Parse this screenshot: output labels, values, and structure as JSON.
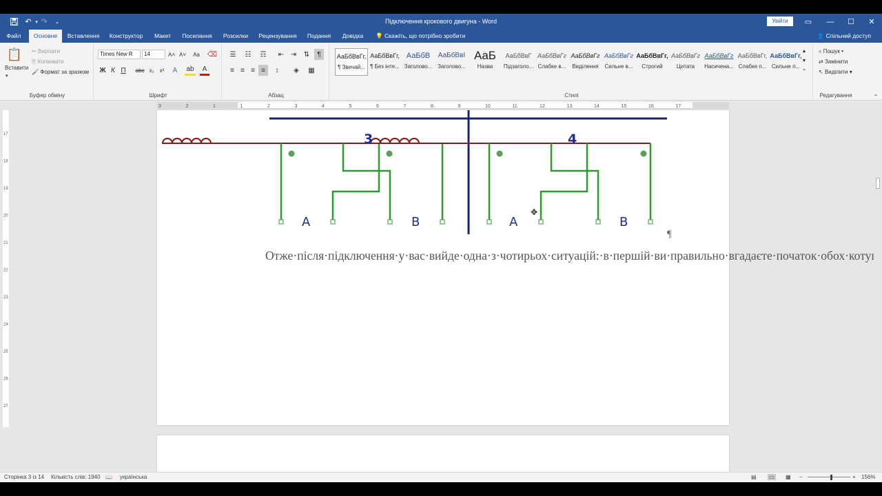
{
  "titlebar": {
    "title": "Підключення крокового двигуна  -  Word",
    "signin": "Увійти",
    "save_icon": "💾",
    "undo_icon": "↶",
    "redo_icon": "↷",
    "customize_icon": "⌄",
    "ribbon_display_icon": "▭",
    "minimize_icon": "—",
    "maximize_icon": "☐",
    "close_icon": "✕"
  },
  "tabs": {
    "items": [
      "Файл",
      "Основне",
      "Вставлення",
      "Конструктор",
      "Макет",
      "Посилання",
      "Розсилки",
      "Рецензування",
      "Подання",
      "Довідка"
    ],
    "tellme": "Скажіть, що потрібно зробити",
    "share": "Спільний доступ"
  },
  "clipboard": {
    "paste": "Вставити",
    "cut": "Вирізати",
    "copy": "Копіювати",
    "format_painter": "Формат за зразком",
    "label": "Буфер обміну"
  },
  "font": {
    "name": "Times New R",
    "size": "14",
    "bold": "Ж",
    "italic": "К",
    "underline": "П",
    "strike": "abc",
    "sub": "x₂",
    "sup": "x²",
    "grow": "A˄",
    "shrink": "A˅",
    "case": "Aa",
    "label": "Шрифт"
  },
  "paragraph_group": {
    "label": "Абзац"
  },
  "styles": {
    "label": "Стилі",
    "items": [
      {
        "preview": "АаБбВвГг,",
        "name": "¶ Звичай..."
      },
      {
        "preview": "АаБбВвГг,",
        "name": "¶ Без інте..."
      },
      {
        "preview": "АаБбВ",
        "name": "Заголово..."
      },
      {
        "preview": "АаБбВвI",
        "name": "Заголово..."
      },
      {
        "preview": "AaБ",
        "name": "Назва"
      },
      {
        "preview": "АаБбВвГ",
        "name": "Підзаголо..."
      },
      {
        "preview": "АаБбВвГг",
        "name": "Слабке в..."
      },
      {
        "preview": "АаБбВвГг",
        "name": "Виділення"
      },
      {
        "preview": "АаБбВвГг",
        "name": "Сильне в..."
      },
      {
        "preview": "АаБбВвГг,",
        "name": "Строгий"
      },
      {
        "preview": "АаБбВвГг",
        "name": "Цитата"
      },
      {
        "preview": "АаБбВвГг",
        "name": "Насичена..."
      },
      {
        "preview": "АаБбВвГг,",
        "name": "Слабке п..."
      },
      {
        "preview": "АаБбВвГг,",
        "name": "Сильне п..."
      }
    ]
  },
  "editing": {
    "find": "Пошук",
    "replace": "Замінити",
    "select": "Виділити",
    "label": "Редагування"
  },
  "ruler": {
    "numbers": [
      "3",
      "2",
      "1",
      "1",
      "2",
      "3",
      "4",
      "5",
      "6",
      "7",
      "8",
      "9",
      "10",
      "11",
      "12",
      "13",
      "14",
      "15",
      "16",
      "17"
    ],
    "vnumbers": [
      "17",
      "18",
      "19",
      "20",
      "21",
      "22",
      "23",
      "24",
      "25",
      "26",
      "27"
    ]
  },
  "diagram": {
    "label_left": "3",
    "label_right": "4",
    "terminals": [
      "A",
      "B",
      "A",
      "B"
    ]
  },
  "document": {
    "paragraph": "Отже·після·підключення·у·вас·вийде·одна·з·чотирьох·ситуацій:·в·першій·ви·правильно·вгадаєте·початок·обох·котушок;·у·другому·випадку·одна·з·котушок·буде·підключена·початком·в·зворотну·сторону;·в·третьому·випадку·ви·вгадаєте·початок·котушок·але·переплутати·пари·виходів·драйвера;·і·в·четвертому·випадку·буде·переплутано·усе·максимально.·Тепер·спробуємо·всі·ці·випадки·на·практиці.¶",
    "pilcrow": "¶"
  },
  "status": {
    "page": "Сторінка 3 із 14",
    "words": "Кількість слів: 1940",
    "language": "українська",
    "zoom": "156%",
    "minus": "−",
    "plus": "+"
  },
  "colors": {
    "brand": "#2b579a",
    "wire": "#2e9a2e",
    "coil": "#8b1a1a",
    "label": "#1f2f8f"
  }
}
